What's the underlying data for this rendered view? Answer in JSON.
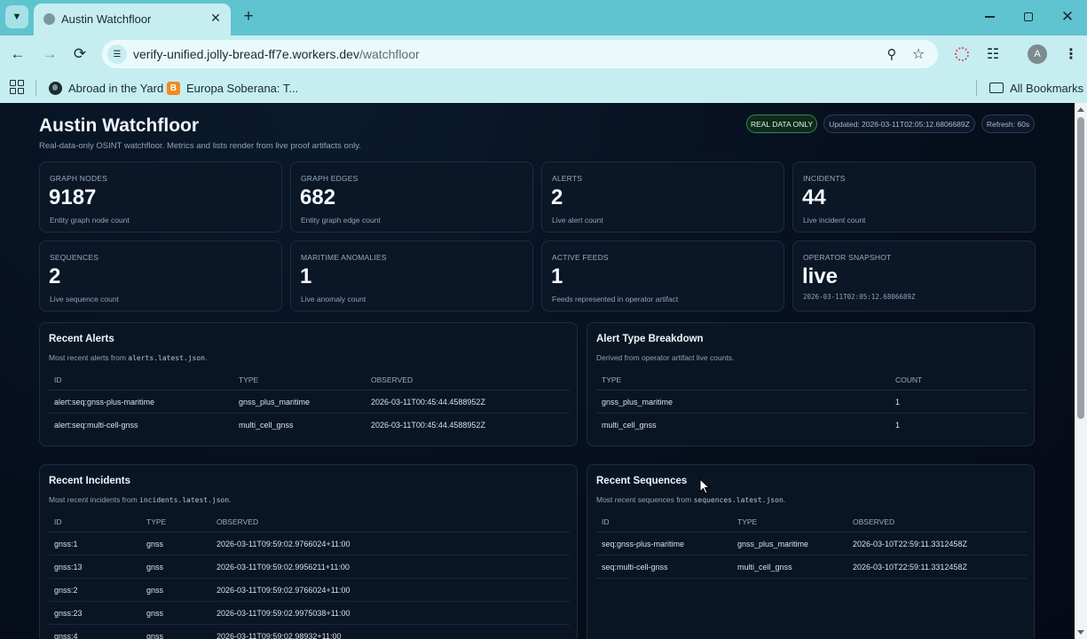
{
  "browser": {
    "tab_title": "Austin Watchfloor",
    "url_host": "verify-unified.jolly-bread-ff7e.workers.dev",
    "url_path": "/watchfloor",
    "avatar_letter": "A",
    "bookmarks": [
      {
        "label": "Abroad in the Yard",
        "icon": "globe-icon"
      },
      {
        "label": "Europa Soberana: T...",
        "icon": "blogger-icon"
      }
    ],
    "all_bookmarks": "All Bookmarks"
  },
  "header": {
    "title": "Austin Watchfloor",
    "subtitle": "Real-data-only OSINT watchfloor. Metrics and lists render from live proof artifacts only.",
    "badge_real": "REAL DATA ONLY",
    "updated": "Updated: 2026-03-11T02:05:12.6806689Z",
    "refresh": "Refresh: 60s"
  },
  "metrics": [
    {
      "label": "GRAPH NODES",
      "value": "9187",
      "note": "Entity graph node count"
    },
    {
      "label": "GRAPH EDGES",
      "value": "682",
      "note": "Entity graph edge count"
    },
    {
      "label": "ALERTS",
      "value": "2",
      "note": "Live alert count"
    },
    {
      "label": "INCIDENTS",
      "value": "44",
      "note": "Live incident count"
    },
    {
      "label": "SEQUENCES",
      "value": "2",
      "note": "Live sequence count"
    },
    {
      "label": "MARITIME ANOMALIES",
      "value": "1",
      "note": "Live anomaly count"
    },
    {
      "label": "ACTIVE FEEDS",
      "value": "1",
      "note": "Feeds represented in operator artifact"
    },
    {
      "label": "OPERATOR SNAPSHOT",
      "value": "live",
      "note": "2026-03-11T02:05:12.6806689Z"
    }
  ],
  "recent_alerts": {
    "title": "Recent Alerts",
    "desc_prefix": "Most recent alerts from ",
    "desc_file": "alerts.latest.json",
    "desc_suffix": ".",
    "headers": [
      "ID",
      "TYPE",
      "OBSERVED"
    ],
    "rows": [
      [
        "alert:seq:gnss-plus-maritime",
        "gnss_plus_maritime",
        "2026-03-11T00:45:44.4588952Z"
      ],
      [
        "alert:seq:multi-cell-gnss",
        "multi_cell_gnss",
        "2026-03-11T00:45:44.4588952Z"
      ]
    ]
  },
  "alert_breakdown": {
    "title": "Alert Type Breakdown",
    "desc": "Derived from operator artifact live counts.",
    "headers": [
      "TYPE",
      "COUNT"
    ],
    "rows": [
      [
        "gnss_plus_maritime",
        "1"
      ],
      [
        "multi_cell_gnss",
        "1"
      ]
    ]
  },
  "recent_incidents": {
    "title": "Recent Incidents",
    "desc_prefix": "Most recent incidents from ",
    "desc_file": "incidents.latest.json",
    "desc_suffix": ".",
    "headers": [
      "ID",
      "TYPE",
      "OBSERVED"
    ],
    "rows": [
      [
        "gnss:1",
        "gnss",
        "2026-03-11T09:59:02.9766024+11:00"
      ],
      [
        "gnss:13",
        "gnss",
        "2026-03-11T09:59:02.9956211+11:00"
      ],
      [
        "gnss:2",
        "gnss",
        "2026-03-11T09:59:02.9766024+11:00"
      ],
      [
        "gnss:23",
        "gnss",
        "2026-03-11T09:59:02.9975038+11:00"
      ],
      [
        "gnss:4",
        "gnss",
        "2026-03-11T09:59:02.98932+11:00"
      ]
    ]
  },
  "recent_sequences": {
    "title": "Recent Sequences",
    "desc_prefix": "Most recent sequences from ",
    "desc_file": "sequences.latest.json",
    "desc_suffix": ".",
    "headers": [
      "ID",
      "TYPE",
      "OBSERVED"
    ],
    "rows": [
      [
        "seq:gnss-plus-maritime",
        "gnss_plus_maritime",
        "2026-03-10T22:59:11.3312458Z"
      ],
      [
        "seq:multi-cell-gnss",
        "multi_cell_gnss",
        "2026-03-10T22:59:11.3312458Z"
      ]
    ]
  }
}
